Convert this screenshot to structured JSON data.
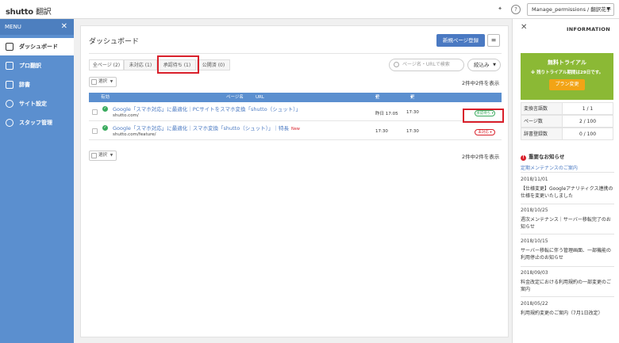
{
  "header": {
    "logo": "shutto",
    "logo_sub": "翻訳",
    "user_select": "Manage_permissions / 翻訳花子"
  },
  "sidebar": {
    "title": "MENU",
    "items": [
      {
        "label": "ダッシュボード",
        "icon": "house-icon"
      },
      {
        "label": "プロ翻訳",
        "icon": "pro-translate-icon"
      },
      {
        "label": "辞書",
        "icon": "book-icon"
      },
      {
        "label": "サイト設定",
        "icon": "gear-icon"
      },
      {
        "label": "スタッフ管理",
        "icon": "users-icon"
      }
    ]
  },
  "main": {
    "title": "ダッシュボード",
    "new_page_button": "新規ページ登録",
    "tabs": [
      {
        "label": "全ページ (2)"
      },
      {
        "label": "未対応 (1)"
      },
      {
        "label": "承認待ち (1)"
      },
      {
        "label": "公開済 (0)"
      }
    ],
    "search_placeholder": "ページ名・URLで検索",
    "filter_label": "絞込み",
    "select_label": "選択",
    "result_count": "2件中2件を表示",
    "columns": [
      "有効",
      "ページ名",
      "URL",
      "登録日",
      "更新日"
    ],
    "rows": [
      {
        "name": "Google「スマホ対応」に最適化｜PCサイトをスマホ変換「shutto（シュット）」",
        "url": "shutto.com/",
        "registered": "昨日 17:05",
        "updated": "17:30",
        "status": "承認待ち",
        "is_new": false
      },
      {
        "name": "Google「スマホ対応」に最適化｜スマホ変換「shutto（シュット）」｜特長",
        "new_label": "New",
        "url": "shutto.com/feature/",
        "registered": "17:30",
        "updated": "17:30",
        "status": "未対応",
        "is_new": true
      }
    ]
  },
  "info": {
    "title": "INFORMATION",
    "trial": {
      "title": "無料トライアル",
      "remaining": "※ 残りトライアル期間は29日です。",
      "button": "プラン変更"
    },
    "stats": [
      {
        "label": "変換言語数",
        "value": "1 / 1"
      },
      {
        "label": "ページ数",
        "value": "2 / 100"
      },
      {
        "label": "辞書登録数",
        "value": "0 / 100"
      }
    ],
    "news_title": "重要なお知らせ",
    "news_link": "定期メンテナンスのご案内",
    "news": [
      {
        "date": "2018/11/01",
        "text": "【仕様変更】Googleアナリティクス連携の仕様を変更いたしました"
      },
      {
        "date": "2018/10/25",
        "text": "週次メンテナンス｜サーバー移転完了のお知らせ"
      },
      {
        "date": "2018/10/15",
        "text": "サーバー移転に伴う管理画面、一部機能の利用停止のお知らせ"
      },
      {
        "date": "2018/09/03",
        "text": "料金改定における利用規約の一部変更のご案内"
      },
      {
        "date": "2018/05/22",
        "text": "利用規約変更のご案内（7月1日改定）"
      }
    ]
  }
}
